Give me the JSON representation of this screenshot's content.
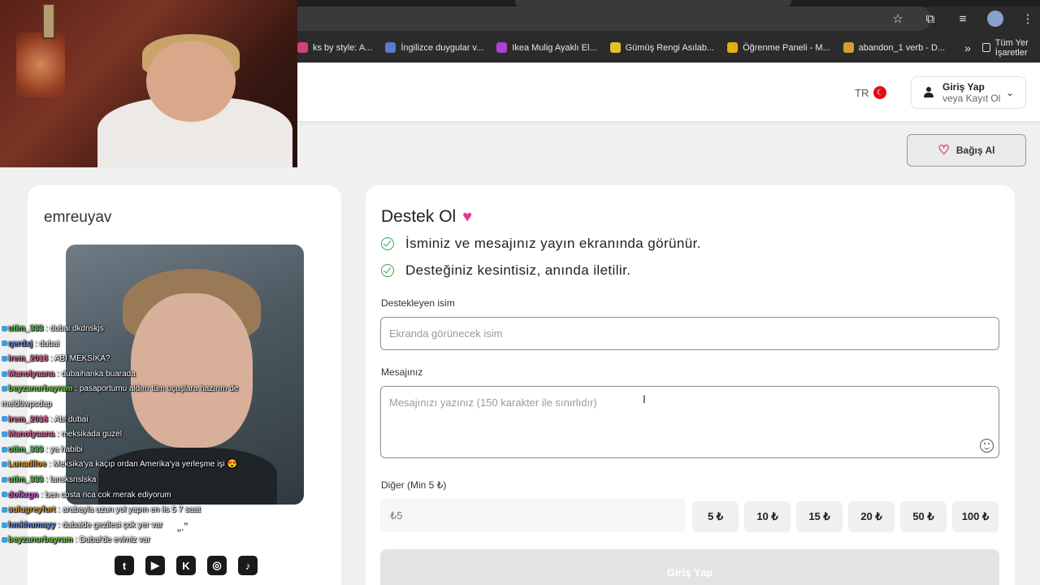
{
  "browser": {
    "bookmarks": [
      {
        "label": "ks by style: A...",
        "color": "#d04080"
      },
      {
        "label": "İngilizce duygular v...",
        "color": "#5a7ad0"
      },
      {
        "label": "Ikea Mulig Ayaklı El...",
        "color": "#b040d0"
      },
      {
        "label": "Gümüş Rengi Asılab...",
        "color": "#e0c030"
      },
      {
        "label": "Öğrenme Paneli - M...",
        "color": "#e0b010"
      },
      {
        "label": "abandon_1 verb - D...",
        "color": "#d0a030"
      }
    ],
    "more": "»",
    "all_bookmarks": "Tüm Yer İşaretler"
  },
  "header": {
    "lang": "TR",
    "login_main": "Giriş Yap",
    "login_sub": "veya Kayıt Ol"
  },
  "donate_button": "Bağış Al",
  "streamer": {
    "name": "emreuyav",
    "socials": [
      "twitch",
      "youtube",
      "kick",
      "instagram",
      "tiktok"
    ]
  },
  "chat": [
    {
      "user": "utim_333",
      "color": "#5ad05a",
      "msg": "dubai dkdnskjs"
    },
    {
      "user": "qerdxj",
      "color": "#6a8ae0",
      "msg": "dubai"
    },
    {
      "user": "irem_2018",
      "color": "#e06aa0",
      "msg": "ABİ MEKSİKA?"
    },
    {
      "user": "Manolyaana",
      "color": "#e06aa0",
      "msg": "dubaihanka buarada"
    },
    {
      "user": "beyzanurbayram",
      "color": "#7ad04a",
      "msg": "pasaportumu aldım tüm uçuşlara hazırım de meldöwpsdap"
    },
    {
      "user": "irem_2018",
      "color": "#e06aa0",
      "msg": "Abi dubai"
    },
    {
      "user": "Manolyaana",
      "color": "#e06aa0",
      "msg": "meksikada guzel"
    },
    {
      "user": "utim_333",
      "color": "#5ad05a",
      "msg": "ya habibi"
    },
    {
      "user": "Lunadiloe",
      "color": "#e0a020",
      "msg": "Meksika'ya kaçıp ordan Amerika'ya yerleşme işi 😍"
    },
    {
      "user": "utim_333",
      "color": "#5ad05a",
      "msg": "lansksnslska"
    },
    {
      "user": "dofkrgn",
      "color": "#d05ad0",
      "msg": "ben costa rica cok merak ediyorum"
    },
    {
      "user": "sulugreyfurt",
      "color": "#d0a040",
      "msg": "arabayla uzun yol yapın en iis 5 7 saat"
    },
    {
      "user": "hmkhumayy",
      "color": "#6a8ae0",
      "msg": "dubaide gezilesi çok yer var"
    },
    {
      "user": "beyzanurbayram",
      "color": "#7ad04a",
      "msg": "Dubai'de evimiz var"
    }
  ],
  "form": {
    "title": "Destek Ol",
    "features": [
      "İsminiz ve mesajınız yayın ekranında görünür.",
      "Desteğiniz kesintisiz, anında iletilir."
    ],
    "name_label": "Destekleyen isim",
    "name_placeholder": "Ekranda görünecek isim",
    "message_label": "Mesajınız",
    "message_placeholder": "Mesajınızı yazınız (150 karakter ile sınırlıdır)",
    "amount_label": "Diğer (Min 5 ₺)",
    "amount_placeholder": "₺5",
    "amounts": [
      "5 ₺",
      "10 ₺",
      "15 ₺",
      "20 ₺",
      "50 ₺",
      "100 ₺"
    ],
    "submit": "Giriş Yap"
  }
}
